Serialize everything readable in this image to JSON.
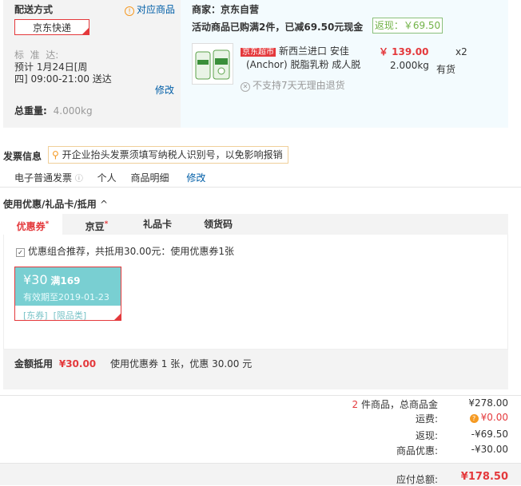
{
  "shipping": {
    "title": "配送方式",
    "match_link": "对应商品",
    "express_label": "京东快递",
    "standard_label": "标  准  达:",
    "schedule_line1": "预计 1月24日[周",
    "schedule_line2": "四] 09:00-21:00 送达",
    "edit_label": "修改",
    "weight_label": "总重量:",
    "weight_value": "4.000kg"
  },
  "merchant": {
    "label": "商家：京东自营",
    "promo_text": "活动商品已购满2件，已减69.50元现金",
    "rebate_badge": "返现：￥69.50"
  },
  "product": {
    "store_tag": "京东超市",
    "name_line1": "新西兰进口 安佳",
    "name_line2": "(Anchor) 脱脂乳粉 成人脱",
    "price": "￥ 139.00",
    "quantity": "x2",
    "weight": "2.000kg",
    "stock": "有货",
    "return_note": "不支持7天无理由退货"
  },
  "invoice": {
    "title": "发票信息",
    "tip": "开企业抬头发票须填写纳税人识别号，以免影响报销",
    "type": "电子普通发票",
    "holder": "个人",
    "detail": "商品明细",
    "edit_label": "修改"
  },
  "discount": {
    "section_title": "使用优惠/礼品卡/抵用",
    "tabs": [
      {
        "label": "优惠券",
        "mark": "*"
      },
      {
        "label": "京豆",
        "mark": "*"
      },
      {
        "label": "礼品卡",
        "mark": ""
      },
      {
        "label": "领货码",
        "mark": ""
      }
    ],
    "combo_text": "优惠组合推荐，共抵用30.00元：使用优惠券1张",
    "coupon": {
      "amount": "¥30",
      "threshold": "满169",
      "validity": "有效期至2019-01-23",
      "tags": "[东券]  [限品类]"
    },
    "summary_label": "金额抵用",
    "summary_amount": "¥30.00",
    "summary_desc": "使用优惠券 1 张，优惠 30.00 元"
  },
  "totals": {
    "count_num": "2",
    "count_label": " 件商品，总商品金",
    "items_value": "¥278.00",
    "shipping_label": "运费:",
    "shipping_value": "¥0.00",
    "rebate_label": "返现:",
    "rebate_value": "-¥69.50",
    "discount_label": "商品优惠:",
    "discount_value": "-¥30.00",
    "payable_label": "应付总额:",
    "payable_value": "¥178.50"
  },
  "colors": {
    "accent_red": "#e4393c",
    "link_blue": "#005ea7",
    "coupon_teal": "#79cfd2",
    "rebate_green": "#71b247"
  }
}
